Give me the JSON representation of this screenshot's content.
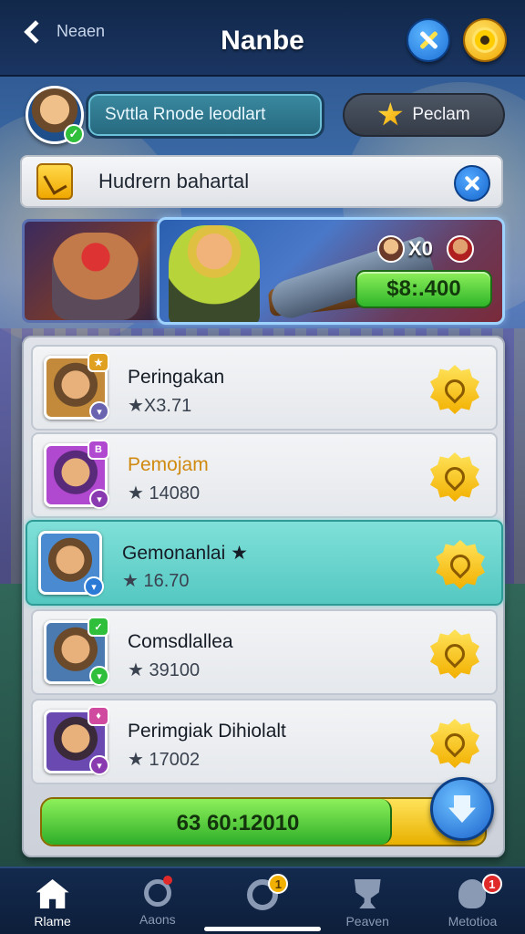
{
  "header": {
    "back_label": "Neaen",
    "title": "Nanbe"
  },
  "profile": {
    "field_text": "Svttla Rnode leodlart",
    "action_label": "Peclam"
  },
  "notice": {
    "text": "Hudrern bahartal"
  },
  "hero": {
    "vs_text": "X0",
    "price": "$8:.400"
  },
  "list": {
    "rows": [
      {
        "name": "Peringakan",
        "score": "★X3.71",
        "badge": "",
        "bottom_badge_color": "#6a64b0",
        "avatar_bg": "#6a4a2a"
      },
      {
        "name": "Pemojam",
        "score": "★ 14080",
        "badge": "",
        "bottom_badge_color": "#8a3ab0",
        "avatar_bg": "#8a3ab0"
      },
      {
        "name": "Gemonanlai ★",
        "score": "★ 16.70",
        "badge": "",
        "bottom_badge_color": "#2a7ad6",
        "avatar_bg": "#3a7ab0"
      },
      {
        "name": "Comsdlallea",
        "score": "★ 39100",
        "badge": "",
        "bottom_badge_color": "#2fbf3a",
        "avatar_bg": "#3a6aa0"
      },
      {
        "name": "Perimgiak Dihiolalt",
        "score": "★ 17002",
        "badge": "",
        "bottom_badge_color": "#8a3ab0",
        "avatar_bg": "#5a4a8a"
      }
    ],
    "highlight_index": 2
  },
  "progress": {
    "label": "63 60:12010",
    "fraction": 0.79
  },
  "nav": {
    "items": [
      {
        "label": "Rlame",
        "icon": "home-icon",
        "active": true
      },
      {
        "label": "Aaons",
        "icon": "search-icon",
        "active": false
      },
      {
        "label": "",
        "icon": "chat-icon",
        "active": false
      },
      {
        "label": "Peaven",
        "icon": "trophy-icon",
        "active": false
      },
      {
        "label": "Metotioa",
        "icon": "user-icon",
        "active": false
      }
    ],
    "badge_chat": "1",
    "badge_user": "1"
  },
  "colors": {
    "accent_green": "#2fb52a",
    "accent_yellow": "#f2b000",
    "accent_blue": "#1c6fd6",
    "highlight_row": "#55c8c2"
  }
}
